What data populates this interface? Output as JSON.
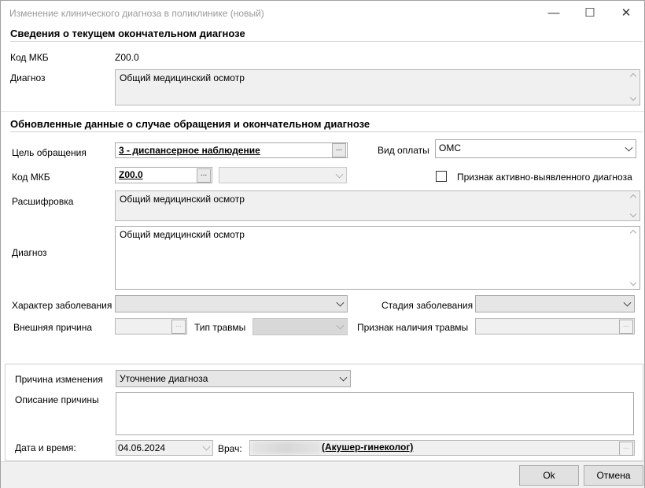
{
  "window": {
    "title": "Изменение клинического диагноза в поликлинике (новый)",
    "minimize_glyph": "—",
    "maximize_glyph": "☐",
    "close_glyph": "✕"
  },
  "current": {
    "section_title": "Сведения о текущем окончательном диагнозе",
    "mkb_label": "Код МКБ",
    "mkb_value": "Z00.0",
    "diagnosis_label": "Диагноз",
    "diagnosis_value": "Общий медицинский осмотр"
  },
  "updated": {
    "section_title": "Обновленные данные о случае обращения и окончательном диагнозе",
    "purpose_label": "Цель обращения",
    "purpose_value": "3 - диспансерное наблюдение",
    "payment_label": "Вид оплаты",
    "payment_value": "ОМС",
    "mkb_label": "Код МКБ",
    "mkb_value": "Z00.0",
    "active_label": "Признак активно-выявленного диагноза",
    "decode_label": "Расшифровка",
    "decode_value": "Общий медицинский осмотр",
    "diagnosis_label": "Диагноз",
    "diagnosis_value": "Общий медицинский осмотр",
    "character_label": "Характер заболевания",
    "character_value": "",
    "stage_label": "Стадия заболевания",
    "stage_value": "",
    "external_label": "Внешняя причина",
    "trauma_type_label": "Тип травмы",
    "trauma_sign_label": "Признак наличия травмы",
    "ellipsis": "..."
  },
  "change": {
    "reason_label": "Причина изменения",
    "reason_value": "Уточнение диагноза",
    "description_label": "Описание причины",
    "description_value": "",
    "datetime_label": "Дата и время:",
    "datetime_value": "04.06.2024",
    "doctor_label": "Врач:",
    "doctor_value": "(Акушер-гинеколог)"
  },
  "footer": {
    "ok_label": "Ok",
    "cancel_label": "Отмена"
  }
}
